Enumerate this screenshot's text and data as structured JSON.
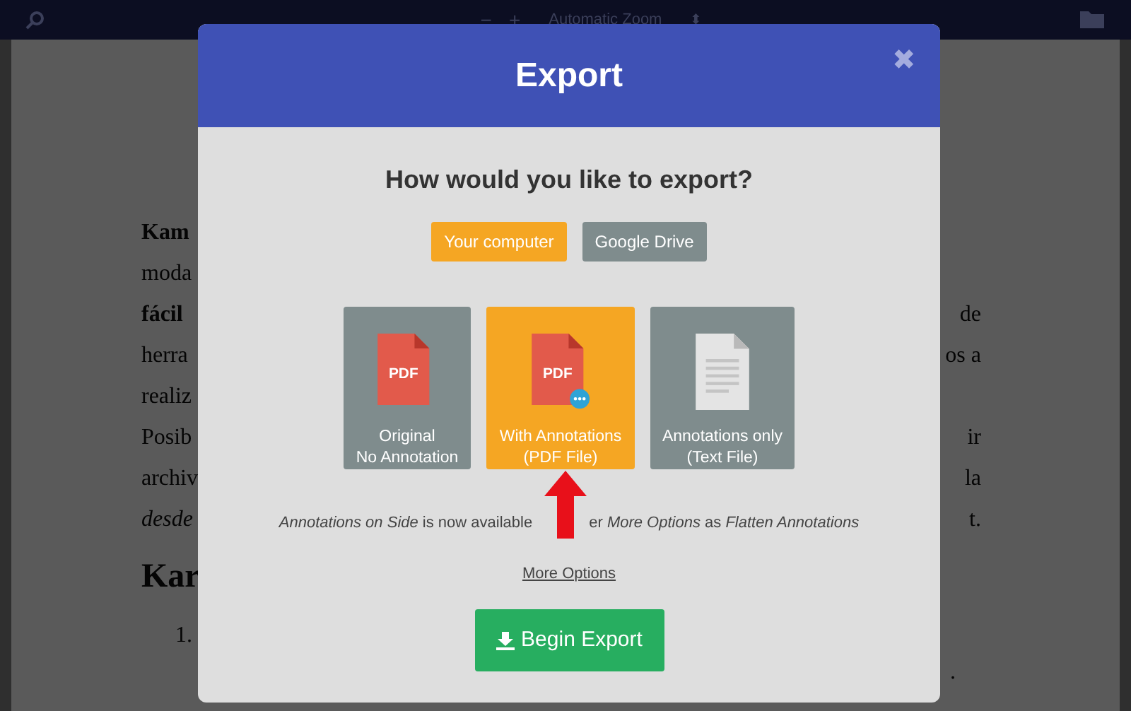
{
  "toolbar": {
    "zoom_out": "−",
    "zoom_in": "+",
    "zoom": "Automatic Zoom",
    "zoom_caret": "⬍"
  },
  "document": {
    "lines": [
      {
        "left": "Kam",
        "kind": "bold"
      },
      {
        "left": "moda",
        "kind": "plain"
      },
      {
        "left": "fácil",
        "kind": "bold",
        "right": "de"
      },
      {
        "left": "herra",
        "kind": "plain",
        "right": "os a"
      },
      {
        "left": "realiz",
        "kind": "plain"
      },
      {
        "left": "Posib",
        "kind": "plain",
        "right": "ir"
      },
      {
        "left": "archiv",
        "kind": "plain",
        "right": "la"
      },
      {
        "left": "desde",
        "kind": "italic",
        "right": "t."
      }
    ],
    "heading": "Kar",
    "list_marker": "1.",
    "trailing": "."
  },
  "dialog": {
    "title": "Export",
    "close": "✖",
    "question": "How would you like to export?",
    "destinations": [
      {
        "label": "Your computer",
        "selected": true
      },
      {
        "label": "Google Drive",
        "selected": false
      }
    ],
    "formats": [
      {
        "kind": "pdf",
        "icon_text": "PDF",
        "line1": "Original",
        "line2": "No Annotation",
        "selected": false
      },
      {
        "kind": "pdf_annotated",
        "icon_text": "PDF",
        "line1": "With Annotations",
        "line2": "(PDF File)",
        "selected": true
      },
      {
        "kind": "text",
        "line1": "Annotations only",
        "line2": "(Text File)",
        "selected": false
      }
    ],
    "note_before": "*Annotations on Side* is now available",
    "note_after": "er *More Options* as *Flatten Annotations*",
    "more_options": "More Options",
    "begin": "Begin Export"
  }
}
